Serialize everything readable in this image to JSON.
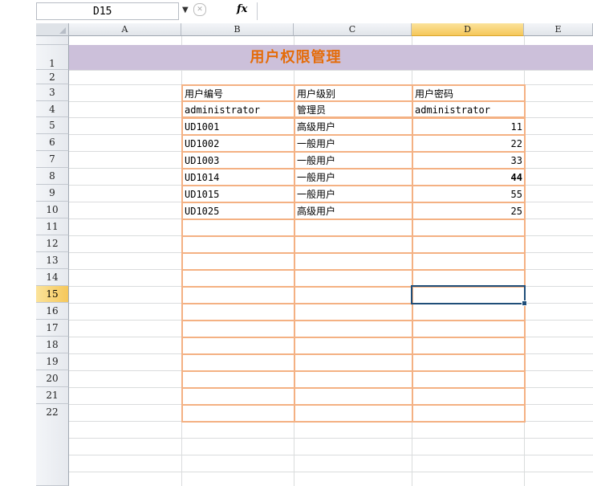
{
  "formula_bar": {
    "name_box": "D15",
    "fx_label": "fx",
    "formula": ""
  },
  "columns": [
    "A",
    "B",
    "C",
    "D",
    "E"
  ],
  "rows": [
    "1",
    "2",
    "3",
    "4",
    "5",
    "6",
    "7",
    "8",
    "9",
    "10",
    "11",
    "12",
    "13",
    "14",
    "15",
    "16",
    "17",
    "18",
    "19",
    "20",
    "21",
    "22"
  ],
  "selected_cell": {
    "column": "D",
    "row": "15"
  },
  "sheet": {
    "title": "用户权限管理",
    "headers": [
      "用户编号",
      "用户级别",
      "用户密码"
    ],
    "records": [
      [
        "administrator",
        "管理员",
        "administrator"
      ],
      [
        "UD1001",
        "高级用户",
        "11"
      ],
      [
        "UD1002",
        "一般用户",
        "22"
      ],
      [
        "UD1003",
        "一般用户",
        "33"
      ],
      [
        "UD1014",
        "一般用户",
        "44"
      ],
      [
        "UD1015",
        "一般用户",
        "55"
      ],
      [
        "UD1025",
        "高级用户",
        "25"
      ]
    ]
  },
  "colors": {
    "title_fill": "#ccc0da",
    "title_text": "#e46c0a",
    "table_border": "#f4b183",
    "selection": "#1f4e79"
  }
}
